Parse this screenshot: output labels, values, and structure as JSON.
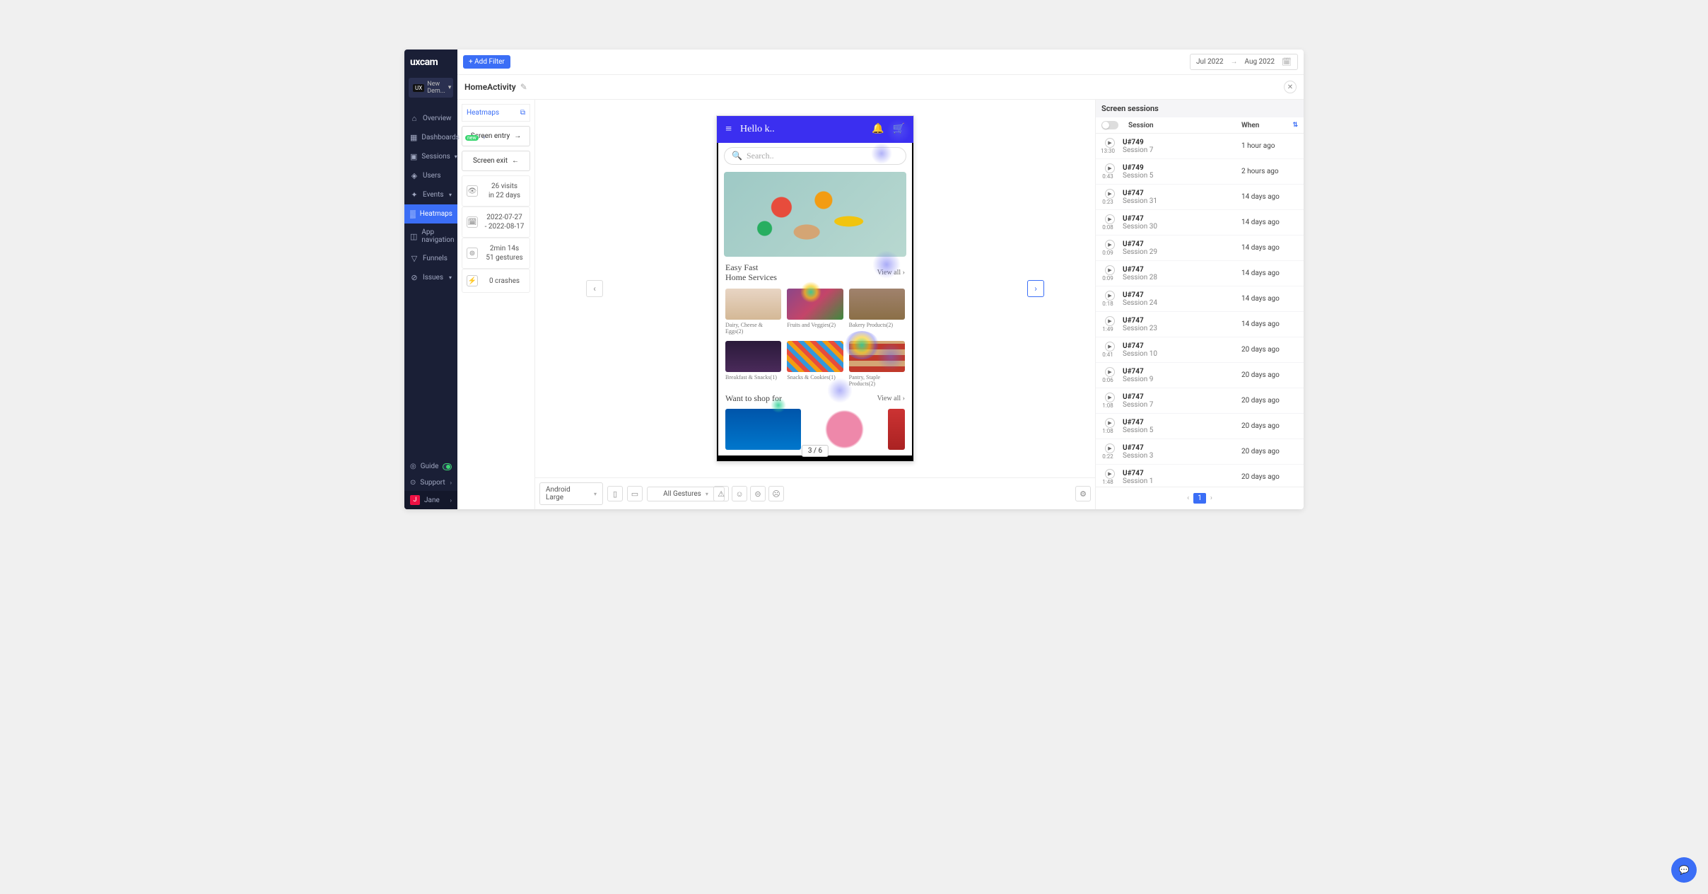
{
  "sidebar": {
    "logo": "uxcam",
    "app_sel": "New Dem...",
    "nav": [
      {
        "icon": "⌂",
        "label": "Overview"
      },
      {
        "icon": "▦",
        "label": "Dashboards",
        "badge": "new",
        "caret": true
      },
      {
        "icon": "▣",
        "label": "Sessions",
        "caret": true
      },
      {
        "icon": "◈",
        "label": "Users"
      },
      {
        "icon": "✦",
        "label": "Events",
        "caret": true
      },
      {
        "icon": "▒",
        "label": "Heatmaps",
        "active": true
      },
      {
        "icon": "◫",
        "label": "App navigation"
      },
      {
        "icon": "▽",
        "label": "Funnels"
      },
      {
        "icon": "⊘",
        "label": "Issues",
        "caret": true
      }
    ],
    "footer": {
      "guide": "Guide",
      "support": "Support",
      "user": "Jane",
      "user_initial": "J"
    }
  },
  "topbar": {
    "add_filter": "+  Add Filter",
    "date_from": "Jul 2022",
    "date_to": "Aug 2022"
  },
  "header": {
    "title": "HomeActivity"
  },
  "leftp": {
    "heatmaps": "Heatmaps",
    "entry": "Screen entry",
    "exit": "Screen exit",
    "stats": [
      {
        "icon": "👁",
        "l1": "26 visits",
        "l2": "in 22 days"
      },
      {
        "icon": "🗓",
        "l1": "2022-07-27",
        "l2": "- 2022-08-17"
      },
      {
        "icon": "⊚",
        "l1": "2min 14s",
        "l2": "51 gestures"
      },
      {
        "icon": "⚡",
        "l1": "0 crashes",
        "l2": ""
      }
    ]
  },
  "phone": {
    "greet": "Hello k..",
    "search": "Search..",
    "sect1_t1": "Easy Fast",
    "sect1_t2": "Home Services",
    "viewall": "View all  ›",
    "grid": [
      "Dairy, Cheese & Eggs(2)",
      "Fruits and Veggies(2)",
      "Bakery Products(2)",
      "Breakfast & Snacks(1)",
      "Snacks & Cookies(1)",
      "Pantry, Staple Products(2)"
    ],
    "sect2": "Want to shop for",
    "counter": "3 / 6"
  },
  "toolbar": {
    "device": "Android Large",
    "gestures": "All Gestures"
  },
  "rightp": {
    "title": "Screen sessions",
    "col_session": "Session",
    "col_when": "When",
    "rows": [
      {
        "dur": "13:30",
        "user": "U#749",
        "sess": "Session 7",
        "when": "1 hour ago"
      },
      {
        "dur": "0:43",
        "user": "U#749",
        "sess": "Session 5",
        "when": "2 hours ago"
      },
      {
        "dur": "0:23",
        "user": "U#747",
        "sess": "Session 31",
        "when": "14 days ago"
      },
      {
        "dur": "0:08",
        "user": "U#747",
        "sess": "Session 30",
        "when": "14 days ago"
      },
      {
        "dur": "0:09",
        "user": "U#747",
        "sess": "Session 29",
        "when": "14 days ago"
      },
      {
        "dur": "0:09",
        "user": "U#747",
        "sess": "Session 28",
        "when": "14 days ago"
      },
      {
        "dur": "0:18",
        "user": "U#747",
        "sess": "Session 24",
        "when": "14 days ago"
      },
      {
        "dur": "1:49",
        "user": "U#747",
        "sess": "Session 23",
        "when": "14 days ago"
      },
      {
        "dur": "0:41",
        "user": "U#747",
        "sess": "Session 10",
        "when": "20 days ago"
      },
      {
        "dur": "0:06",
        "user": "U#747",
        "sess": "Session 9",
        "when": "20 days ago"
      },
      {
        "dur": "1:08",
        "user": "U#747",
        "sess": "Session 7",
        "when": "20 days ago"
      },
      {
        "dur": "1:08",
        "user": "U#747",
        "sess": "Session 5",
        "when": "20 days ago"
      },
      {
        "dur": "0:22",
        "user": "U#747",
        "sess": "Session 3",
        "when": "20 days ago"
      },
      {
        "dur": "1:48",
        "user": "U#747",
        "sess": "Session 1",
        "when": "20 days ago"
      }
    ],
    "page": "1"
  }
}
